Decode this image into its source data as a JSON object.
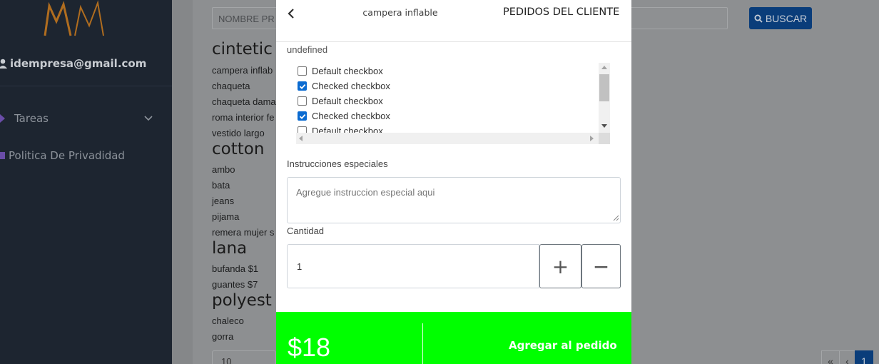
{
  "sidebar": {
    "email": "idempresa@gmail.com",
    "items": [
      {
        "label": "Tareas"
      },
      {
        "label": "Politica De Privadidad"
      }
    ]
  },
  "background": {
    "search_placeholder": "NOMBRE PR",
    "search_button": "BUSCAR",
    "categories": [
      {
        "title": "cintetic",
        "products": [
          "campera inflab",
          "chaqueta",
          "chaqueta dama",
          "roma interior fe",
          "vestido largo"
        ]
      },
      {
        "title": "cotton",
        "products": [
          "ambo",
          "bata",
          "jeans",
          "pijama",
          "remera mujer s"
        ]
      },
      {
        "title": "lana",
        "products": [
          "bufanda  $1",
          "guantes  $7"
        ]
      },
      {
        "title": "polyest",
        "products": [
          "chaleco",
          "gorra"
        ]
      }
    ],
    "page_size": "10",
    "pager": {
      "first": "«",
      "prev": "‹",
      "current": "1"
    }
  },
  "modal": {
    "product_name": "campera inflable",
    "header_title": "PEDIDOS DEL CLIENTE",
    "section_label": "undefined",
    "checkboxes": [
      {
        "label": "Default checkbox",
        "checked": false
      },
      {
        "label": "Checked checkbox",
        "checked": true
      },
      {
        "label": "Default checkbox",
        "checked": false
      },
      {
        "label": "Checked checkbox",
        "checked": true
      },
      {
        "label": "Default checkbox",
        "checked": false
      }
    ],
    "instructions_label": "Instrucciones especiales",
    "instructions_placeholder": "Agregue instruccion especial aqui",
    "quantity_label": "Cantidad",
    "quantity_value": "1",
    "plus": "+",
    "minus": "−",
    "price": "$18",
    "add_button": "Agregar al pedido"
  },
  "colors": {
    "sidebar_bg": "#1d2530",
    "footer_green": "#00ff00",
    "checkbox_blue": "#0b6bd1",
    "search_button_bg": "#0a3d7a",
    "logo_orange": "#d07a1c"
  },
  "icons": {
    "back": "chevron-left-icon",
    "user": "user-icon",
    "tasks": "chevron-down-icon",
    "search": "search-icon"
  }
}
